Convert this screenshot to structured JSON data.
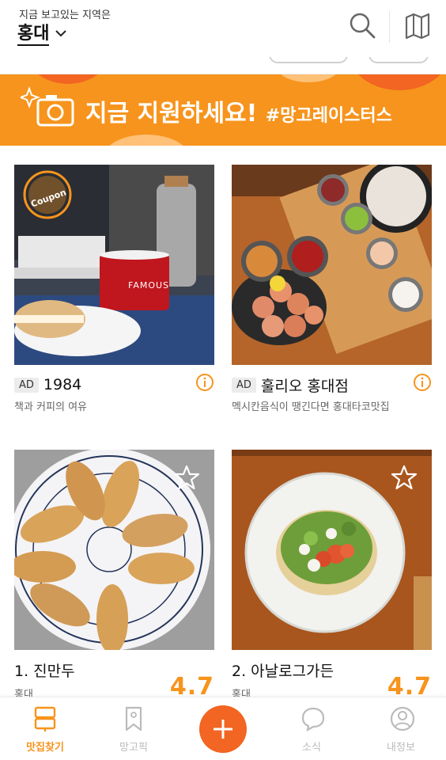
{
  "header": {
    "region_caption": "지금 보고있는 지역은",
    "region_name": "홍대"
  },
  "banner": {
    "title": "지금 지원하세요!",
    "tag": "#망고레이스터스"
  },
  "ad_cards": [
    {
      "ad_label": "AD",
      "title": "1984",
      "subtitle": "책과 커피의 여유",
      "coupon": "Coupon"
    },
    {
      "ad_label": "AD",
      "title": "훌리오 홍대점",
      "subtitle": "멕시칸음식이 땡긴다면 홍대타코맛집"
    }
  ],
  "ranked_cards": [
    {
      "rank_title": "1. 진만두",
      "region": "홍대",
      "rating": "4.7"
    },
    {
      "rank_title": "2. 아날로그가든",
      "region": "홍대",
      "rating": "4.7"
    }
  ],
  "mug_text": "FAMOUS",
  "tabbar": {
    "tabs": [
      {
        "label": "맛집찾기",
        "icon": "restaurant-sign-icon",
        "active": true
      },
      {
        "label": "망고픽",
        "icon": "bookmark-icon",
        "active": false
      },
      {
        "label": "소식",
        "icon": "chat-bubble-icon",
        "active": false
      },
      {
        "label": "내정보",
        "icon": "profile-icon",
        "active": false
      }
    ],
    "fab_icon": "plus-icon"
  },
  "colors": {
    "accent": "#f7941d",
    "fab": "#f26522",
    "inactive": "#bbbbbb"
  }
}
